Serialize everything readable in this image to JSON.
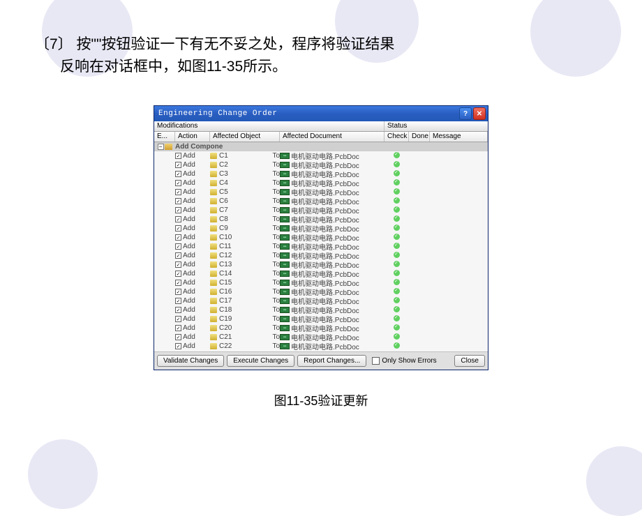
{
  "slide": {
    "text_line1": "〔7〕 按\"\"按钮验证一下有无不妥之处，程序将验证结果",
    "text_line2": "反响在对话框中，如图11-35所示。",
    "caption": "图11-35验证更新"
  },
  "dialog": {
    "title": "Engineering Change Order",
    "section_mod": "Modifications",
    "section_status": "Status",
    "cols": {
      "e": "E...",
      "action": "Action",
      "obj": "Affected Object",
      "doc": "Affected Document",
      "check": "Check",
      "done": "Done",
      "msg": "Message"
    },
    "group": "Add Compone",
    "to": "To",
    "doc_name": "电机驱动电路.PcbDoc",
    "rows": [
      {
        "action": "Add",
        "obj": "C1"
      },
      {
        "action": "Add",
        "obj": "C2"
      },
      {
        "action": "Add",
        "obj": "C3"
      },
      {
        "action": "Add",
        "obj": "C4"
      },
      {
        "action": "Add",
        "obj": "C5"
      },
      {
        "action": "Add",
        "obj": "C6"
      },
      {
        "action": "Add",
        "obj": "C7"
      },
      {
        "action": "Add",
        "obj": "C8"
      },
      {
        "action": "Add",
        "obj": "C9"
      },
      {
        "action": "Add",
        "obj": "C10"
      },
      {
        "action": "Add",
        "obj": "C11"
      },
      {
        "action": "Add",
        "obj": "C12"
      },
      {
        "action": "Add",
        "obj": "C13"
      },
      {
        "action": "Add",
        "obj": "C14"
      },
      {
        "action": "Add",
        "obj": "C15"
      },
      {
        "action": "Add",
        "obj": "C16"
      },
      {
        "action": "Add",
        "obj": "C17"
      },
      {
        "action": "Add",
        "obj": "C18"
      },
      {
        "action": "Add",
        "obj": "C19"
      },
      {
        "action": "Add",
        "obj": "C20"
      },
      {
        "action": "Add",
        "obj": "C21"
      },
      {
        "action": "Add",
        "obj": "C22"
      }
    ],
    "buttons": {
      "validate": "Validate Changes",
      "execute": "Execute Changes",
      "report": "Report Changes...",
      "only_show": "Only Show Errors",
      "close": "Close"
    }
  }
}
